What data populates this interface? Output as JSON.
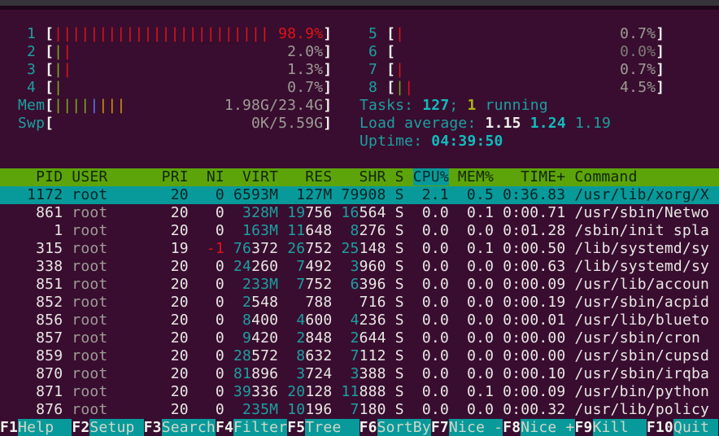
{
  "accent_colors": {
    "background": "#390d30",
    "header_green": "#5da40a",
    "selection_teal": "#089a9a",
    "bar_red": "#e01414",
    "bar_green": "#7ab018",
    "bar_blue": "#5c78e6",
    "bar_orange": "#d29a06",
    "text_teal": "#1ba0a0",
    "text_gray": "#9d9d94"
  },
  "meters": {
    "left": [
      {
        "label": "1",
        "bars": "rrrrrrrrrrrrrrrrrrrrrrrr",
        "value": "98.9%",
        "vc": "red"
      },
      {
        "label": "2",
        "bars": "gr",
        "value": "2.0%",
        "vc": "gray"
      },
      {
        "label": "3",
        "bars": "gr",
        "value": "1.3%",
        "vc": "gray"
      },
      {
        "label": "4",
        "bars": "g",
        "value": "0.7%",
        "vc": "gray"
      },
      {
        "label": "Mem",
        "bars": "ggggbooo",
        "value": "1.98G/23.4G",
        "vc": "gray"
      },
      {
        "label": "Swp",
        "bars": "",
        "value": "0K/5.59G",
        "vc": "gray"
      }
    ],
    "right": [
      {
        "label": "5",
        "bars": "r",
        "value": "0.7%",
        "vc": "gray"
      },
      {
        "label": "6",
        "bars": "",
        "value": "0.0%",
        "vc": "dim"
      },
      {
        "label": "7",
        "bars": "r",
        "value": "0.7%",
        "vc": "gray"
      },
      {
        "label": "8",
        "bars": "gr",
        "value": "4.5%",
        "vc": "gray"
      }
    ]
  },
  "status": {
    "tasks_line": [
      {
        "t": "Tasks: ",
        "c": "teal"
      },
      {
        "t": "127",
        "c": "cyanb"
      },
      {
        "t": "; ",
        "c": "teal"
      },
      {
        "t": "1",
        "c": "limeb"
      },
      {
        "t": " running",
        "c": "teal"
      }
    ],
    "load_line": [
      {
        "t": "Load average: ",
        "c": "teal"
      },
      {
        "t": "1.15",
        "c": "whiteb"
      },
      {
        "t": " ",
        "c": "teal"
      },
      {
        "t": "1.24",
        "c": "cyanb"
      },
      {
        "t": " ",
        "c": "teal"
      },
      {
        "t": "1.19",
        "c": "teal"
      }
    ],
    "uptime_line": [
      {
        "t": "Uptime: ",
        "c": "teal"
      },
      {
        "t": "04:39:50",
        "c": "cyanb"
      }
    ]
  },
  "table": {
    "columns": [
      "PID",
      "USER",
      "PRI",
      "NI",
      "VIRT",
      "RES",
      "SHR",
      "S",
      "CPU%",
      "MEM%",
      "TIME+",
      "Command"
    ],
    "sort_column": "CPU%",
    "selected_index": 0,
    "rows": [
      [
        "1172",
        "root",
        "20",
        "0",
        "6593M",
        "127M",
        "79908",
        "S",
        "2.1",
        "0.5",
        "0:36.83",
        "/usr/lib/xorg/X"
      ],
      [
        "861",
        "root",
        "20",
        "0",
        "328M",
        "19756",
        "16564",
        "S",
        "0.0",
        "0.1",
        "0:00.71",
        "/usr/sbin/Netwo"
      ],
      [
        "1",
        "root",
        "20",
        "0",
        "163M",
        "11648",
        "8276",
        "S",
        "0.0",
        "0.0",
        "0:01.28",
        "/sbin/init spla"
      ],
      [
        "315",
        "root",
        "19",
        "-1",
        "76372",
        "26752",
        "25148",
        "S",
        "0.0",
        "0.1",
        "0:00.50",
        "/lib/systemd/sy"
      ],
      [
        "338",
        "root",
        "20",
        "0",
        "24260",
        "7492",
        "3960",
        "S",
        "0.0",
        "0.0",
        "0:00.63",
        "/lib/systemd/sy"
      ],
      [
        "851",
        "root",
        "20",
        "0",
        "233M",
        "7752",
        "6396",
        "S",
        "0.0",
        "0.0",
        "0:00.09",
        "/usr/lib/accoun"
      ],
      [
        "852",
        "root",
        "20",
        "0",
        "2548",
        "788",
        "716",
        "S",
        "0.0",
        "0.0",
        "0:00.19",
        "/usr/sbin/acpid"
      ],
      [
        "856",
        "root",
        "20",
        "0",
        "8400",
        "4600",
        "4236",
        "S",
        "0.0",
        "0.0",
        "0:00.01",
        "/usr/lib/blueto"
      ],
      [
        "857",
        "root",
        "20",
        "0",
        "9420",
        "2848",
        "2644",
        "S",
        "0.0",
        "0.0",
        "0:00.00",
        "/usr/sbin/cron"
      ],
      [
        "859",
        "root",
        "20",
        "0",
        "28572",
        "8632",
        "7112",
        "S",
        "0.0",
        "0.0",
        "0:00.00",
        "/usr/sbin/cupsd"
      ],
      [
        "870",
        "root",
        "20",
        "0",
        "81896",
        "3724",
        "3388",
        "S",
        "0.0",
        "0.0",
        "0:00.10",
        "/usr/sbin/irqba"
      ],
      [
        "871",
        "root",
        "20",
        "0",
        "39336",
        "20128",
        "11888",
        "S",
        "0.0",
        "0.1",
        "0:00.09",
        "/usr/bin/python"
      ],
      [
        "876",
        "root",
        "20",
        "0",
        "235M",
        "10196",
        "7180",
        "S",
        "0.0",
        "0.0",
        "0:00.32",
        "/usr/lib/policy"
      ]
    ]
  },
  "fnbar": [
    {
      "key": "F1",
      "label": "Help  "
    },
    {
      "key": "F2",
      "label": "Setup "
    },
    {
      "key": "F3",
      "label": "Search"
    },
    {
      "key": "F4",
      "label": "Filter"
    },
    {
      "key": "F5",
      "label": "Tree  "
    },
    {
      "key": "F6",
      "label": "SortBy"
    },
    {
      "key": "F7",
      "label": "Nice -"
    },
    {
      "key": "F8",
      "label": "Nice +"
    },
    {
      "key": "F9",
      "label": "Kill  "
    },
    {
      "key": "F10",
      "label": "Quit "
    }
  ]
}
